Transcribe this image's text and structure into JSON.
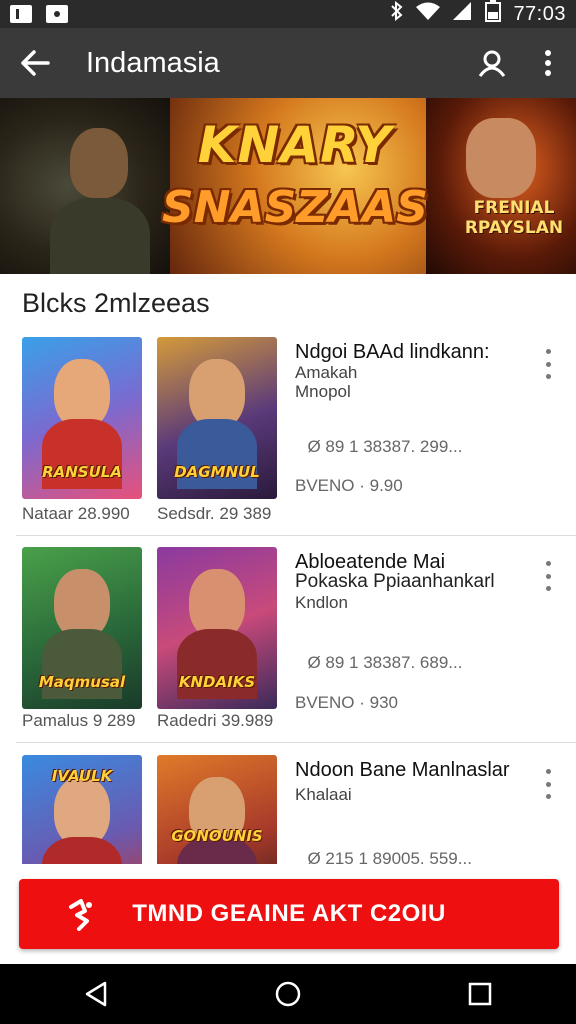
{
  "status_bar": {
    "time": "77:03"
  },
  "app_bar": {
    "title": "Indamasia"
  },
  "banner": {
    "title_line1": "KNARY",
    "title_line2": "SNASZAAS",
    "side_line1": "FRENIAL",
    "side_line2": "RPAYSLAN"
  },
  "section": {
    "title": "Blcks 2mlzeeas"
  },
  "items": [
    {
      "thumb_left_label": "RANSULA",
      "thumb_right_label": "DAGMNUL",
      "caption_left": "Nataar 28.990",
      "caption_right": "Sedsdr. 29 389",
      "title": "Ndgoi BAAd lindkann:",
      "sub1": "Amakah",
      "sub2": "Mnopol",
      "meta1": "⠀Ø  89 1 38387. 299...",
      "meta2": "BVENO · 9.90"
    },
    {
      "thumb_left_label": "Maqmusal",
      "thumb_right_label": "KNDAIKS",
      "caption_left": "Pamalus 9 289",
      "caption_right": "Radedri 39.989",
      "title": "Abloeatende Mai",
      "sub1": "Pokaska Ppiaanhankarl",
      "sub2": "Kndlon",
      "meta1": "⠀Ø  89 1 38387. 689...",
      "meta2": "BVENO · 930"
    },
    {
      "thumb_left_label": "IVAULK",
      "thumb_right_label": "GONOUNIS",
      "caption_left": "",
      "caption_right": "",
      "title": "Ndoon Bane Manlnaslar",
      "sub1": "Khalaai",
      "sub2": "",
      "meta1": "⠀Ø  215 1 89005. 559...",
      "meta2": ""
    }
  ],
  "cta": {
    "label": "TMND GEAINE AKT C2OIU"
  },
  "colors": {
    "accent": "#ee1010",
    "appbar": "#3a3a3a",
    "statusbar": "#2b2b2b"
  }
}
